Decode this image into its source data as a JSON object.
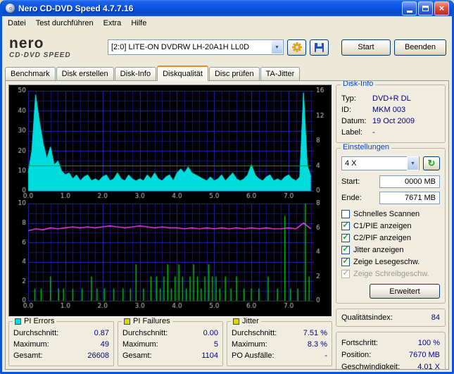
{
  "window": {
    "title": "Nero CD-DVD Speed 4.7.7.16"
  },
  "menu": {
    "items": [
      "Datei",
      "Test durchführen",
      "Extra",
      "Hilfe"
    ]
  },
  "logo": {
    "name": "nero",
    "subtitle": "CD·DVD SPEED"
  },
  "toolbar": {
    "drive": "[2:0]   LITE-ON DVDRW LH-20A1H LL0D",
    "start_label": "Start",
    "quit_label": "Beenden"
  },
  "tabs": {
    "active": "Diskqualität",
    "items": [
      "Benchmark",
      "Disk erstellen",
      "Disk-Info",
      "Diskqualität",
      "Disc prüfen",
      "TA-Jitter"
    ]
  },
  "disk_info": {
    "title": "Disk-Info",
    "rows": [
      {
        "label": "Typ:",
        "value": "DVD+R DL"
      },
      {
        "label": "ID:",
        "value": "MKM 003"
      },
      {
        "label": "Datum:",
        "value": "19 Oct 2009"
      },
      {
        "label": "Label:",
        "value": "-"
      }
    ]
  },
  "settings": {
    "title": "Einstellungen",
    "speed_value": "4 X",
    "start_label": "Start:",
    "start_value": "0000 MB",
    "end_label": "Ende:",
    "end_value": "7671 MB",
    "advanced_label": "Erweitert",
    "checkboxes": [
      {
        "label": "Schnelles Scannen",
        "checked": false,
        "disabled": false
      },
      {
        "label": "C1/PIE anzeigen",
        "checked": true,
        "disabled": false
      },
      {
        "label": "C2/PIF anzeigen",
        "checked": true,
        "disabled": false
      },
      {
        "label": "Jitter anzeigen",
        "checked": true,
        "disabled": false
      },
      {
        "label": "Zeige Lesegeschw.",
        "checked": true,
        "disabled": false
      },
      {
        "label": "Zeige Schreibgeschw.",
        "checked": true,
        "disabled": true
      }
    ]
  },
  "quality": {
    "label": "Qualitätsindex:",
    "value": "84"
  },
  "progress": {
    "rows": [
      {
        "label": "Fortschritt:",
        "value": "100 %"
      },
      {
        "label": "Position:",
        "value": "7670 MB"
      },
      {
        "label": "Geschwindigkeit:",
        "value": "4.01 X"
      }
    ]
  },
  "stats": {
    "pi_errors": {
      "title": "PI Errors",
      "color": "#00DCDC",
      "rows": [
        [
          "Durchschnitt:",
          "0.87"
        ],
        [
          "Maximum:",
          "49"
        ],
        [
          "Gesamt:",
          "26608"
        ]
      ]
    },
    "pi_failures": {
      "title": "PI Failures",
      "color": "#D6D600",
      "rows": [
        [
          "Durchschnitt:",
          "0.00"
        ],
        [
          "Maximum:",
          "5"
        ],
        [
          "Gesamt:",
          "1104"
        ]
      ]
    },
    "jitter": {
      "title": "Jitter",
      "color": "#D6D600",
      "rows": [
        [
          "Durchschnitt:",
          "7.51 %"
        ],
        [
          "Maximum:",
          "8.3 %"
        ],
        [
          "PO Ausfälle:",
          "-"
        ]
      ]
    }
  },
  "chart_data": [
    {
      "name": "PI Errors (C1/PIE) vs. Position",
      "type": "area",
      "xlim": [
        0,
        7.68
      ],
      "x_minor": 0.2,
      "x_ticks": [
        "0.0",
        "1.0",
        "2.0",
        "3.0",
        "4.0",
        "5.0",
        "6.0",
        "7.0"
      ],
      "ylim_left": [
        0,
        50
      ],
      "y_ticks_left": [
        0,
        10,
        20,
        30,
        40,
        50
      ],
      "y_minor": 5,
      "ylim_right": [
        0,
        16
      ],
      "y_ticks_right": [
        0,
        4,
        8,
        12,
        16
      ],
      "series": [
        {
          "name": "C1/PIE",
          "kind": "area",
          "axis": "left",
          "color": "#00f0f0",
          "fill": "#00dcdc",
          "x_start": 0,
          "x_step": 0.1,
          "values": [
            9,
            20,
            48,
            35,
            24,
            16,
            22,
            13,
            15,
            10,
            8,
            9,
            6,
            8,
            5,
            7,
            8,
            5,
            6,
            5,
            7,
            8,
            5,
            6,
            9,
            6,
            5,
            8,
            6,
            5,
            6,
            5,
            8,
            6,
            9,
            6,
            5,
            7,
            8,
            5,
            9,
            11,
            9,
            12,
            9,
            8,
            7,
            6,
            5,
            7,
            5,
            6,
            8,
            5,
            7,
            9,
            6,
            5,
            6,
            8,
            13,
            8,
            6,
            5,
            7,
            8,
            5,
            6,
            5,
            7,
            8,
            6,
            5,
            7,
            49,
            13,
            7
          ]
        },
        {
          "name": "Lesegeschwindigkeit",
          "kind": "line",
          "axis": "right",
          "color": "#00a000",
          "x": [
            0,
            7.6
          ],
          "values": [
            4,
            4
          ]
        }
      ]
    },
    {
      "name": "PI Failures (C2/PIF) und Jitter vs. Position",
      "type": "mixed",
      "xlim": [
        0,
        7.68
      ],
      "x_minor": 0.2,
      "x_ticks": [
        "0.0",
        "1.0",
        "2.0",
        "3.0",
        "4.0",
        "5.0",
        "6.0",
        "7.0"
      ],
      "ylim_left": [
        0,
        10
      ],
      "y_ticks_left": [
        0,
        2,
        4,
        6,
        8,
        10
      ],
      "y_minor": 1,
      "ylim_right": [
        0,
        8
      ],
      "y_ticks_right": [
        0,
        2,
        4,
        6,
        8
      ],
      "series": [
        {
          "name": "C2/PIF",
          "kind": "bar",
          "axis": "right",
          "color": "#00cc00",
          "x": [
            0.18,
            0.35,
            0.6,
            0.82,
            0.95,
            1.2,
            1.45,
            1.7,
            1.85,
            2.05,
            2.3,
            2.55,
            2.75,
            2.9,
            3.1,
            3.3,
            3.45,
            3.55,
            3.65,
            3.75,
            3.85,
            3.95,
            4.05,
            4.15,
            4.25,
            4.35,
            4.45,
            4.55,
            4.65,
            4.75,
            4.85,
            4.95,
            5.05,
            5.15,
            5.3,
            5.45,
            5.6,
            5.8,
            6.0,
            6.2,
            6.45,
            6.7,
            6.9,
            7.05,
            7.25,
            7.45,
            7.55
          ],
          "values": [
            1,
            1,
            2,
            1,
            1,
            1,
            1,
            2,
            1,
            1,
            1,
            1,
            1,
            3,
            1,
            2,
            2,
            1,
            2,
            3,
            1,
            2,
            3,
            2,
            1,
            2,
            3,
            2,
            1,
            2,
            3,
            2,
            2,
            1,
            2,
            1,
            2,
            1,
            1,
            1,
            2,
            1,
            7,
            1,
            1,
            8,
            2
          ]
        },
        {
          "name": "Jitter",
          "kind": "line",
          "axis": "left",
          "color": "#ff46ff",
          "width": 1.4,
          "x_start": 0,
          "x_step": 0.2,
          "values": [
            7.2,
            7.4,
            7.3,
            7.5,
            7.4,
            7.5,
            7.6,
            7.5,
            7.6,
            7.5,
            7.6,
            7.7,
            7.6,
            7.5,
            7.6,
            7.7,
            7.6,
            7.5,
            7.6,
            7.5,
            7.5,
            7.4,
            7.5,
            7.4,
            7.5,
            7.4,
            7.5,
            7.4,
            7.5,
            7.4,
            7.5,
            7.4,
            7.5,
            7.4,
            7.4,
            7.5,
            7.4,
            8.0,
            7.4
          ]
        }
      ]
    }
  ]
}
